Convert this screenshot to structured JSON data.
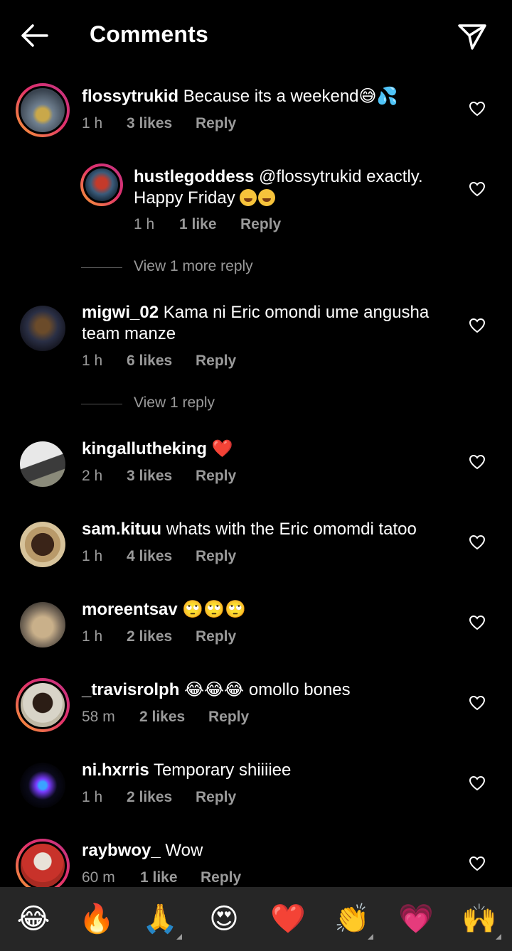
{
  "header": {
    "title": "Comments"
  },
  "comments": [
    {
      "username": "flossytrukid",
      "text": "Because its a weekend",
      "time": "1 h",
      "likes": "3 likes",
      "reply": "Reply"
    },
    {
      "username": "hustlegoddess",
      "text": "@flossytrukid exactly. Happy Friday",
      "time": "1 h",
      "likes": "1 like",
      "reply": "Reply"
    },
    {
      "username": "migwi_02",
      "text": "Kama ni Eric omondi ume angusha team manze",
      "time": "1 h",
      "likes": "6 likes",
      "reply": "Reply"
    },
    {
      "username": "kingallutheking",
      "text": "",
      "time": "2 h",
      "likes": "3 likes",
      "reply": "Reply"
    },
    {
      "username": "sam.kituu",
      "text": "whats with the Eric omomdi tatoo",
      "time": "1 h",
      "likes": "4 likes",
      "reply": "Reply"
    },
    {
      "username": "moreentsav",
      "text": "",
      "time": "1 h",
      "likes": "2 likes",
      "reply": "Reply"
    },
    {
      "username": "_travisrolph",
      "text": "omollo bones",
      "time": "58 m",
      "likes": "2 likes",
      "reply": "Reply"
    },
    {
      "username": "ni.hxrris",
      "text": "Temporary shiiiiee",
      "time": "1 h",
      "likes": "2 likes",
      "reply": "Reply"
    },
    {
      "username": "raybwoy_",
      "text": "Wow",
      "time": "60 m",
      "likes": "1 like",
      "reply": "Reply"
    }
  ],
  "view_more": [
    {
      "label": "View 1 more reply"
    },
    {
      "label": "View 1 reply"
    }
  ],
  "emoji_bar": [
    "😂",
    "🔥",
    "🙏",
    "😍",
    "❤️",
    "👏",
    "💗",
    "🙌"
  ],
  "inline_emojis": {
    "c0": "😅💦",
    "c3": "❤️",
    "c5": "🙄🙄🙄",
    "c6": "😂😂😂"
  },
  "colors": {
    "background": "#000000",
    "meta": "#9a9a9a",
    "emoji_bar": "#262626"
  }
}
